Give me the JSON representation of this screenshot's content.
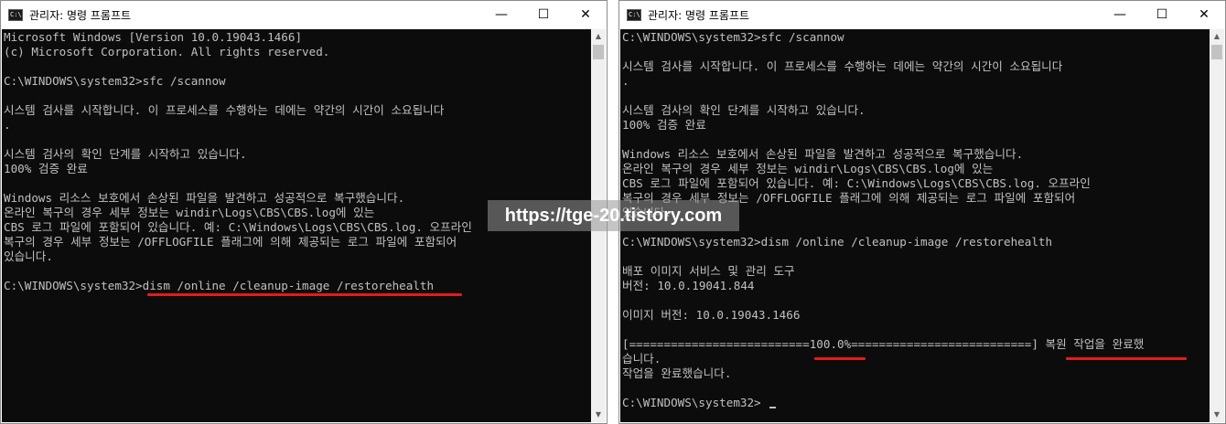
{
  "colors": {
    "console_bg": "#0c0c0c",
    "console_fg": "#c0c0c0",
    "highlight": "#e31b1b"
  },
  "left_window": {
    "title": "관리자: 명령 프롬프트",
    "icon_label": "C:\\",
    "controls": {
      "minimize": "—",
      "maximize": "☐",
      "close": "✕"
    },
    "lines": [
      "Microsoft Windows [Version 10.0.19043.1466]",
      "(c) Microsoft Corporation. All rights reserved.",
      "",
      "C:\\WINDOWS\\system32>sfc /scannow",
      "",
      "시스템 검사를 시작합니다. 이 프로세스를 수행하는 데에는 약간의 시간이 소요됩니다",
      ".",
      "",
      "시스템 검사의 확인 단계를 시작하고 있습니다.",
      "100% 검증 완료",
      "",
      "Windows 리소스 보호에서 손상된 파일을 발견하고 성공적으로 복구했습니다.",
      "온라인 복구의 경우 세부 정보는 windir\\Logs\\CBS\\CBS.log에 있는",
      "CBS 로그 파일에 포함되어 있습니다. 예: C:\\Windows\\Logs\\CBS\\CBS.log. 오프라인",
      "복구의 경우 세부 정보는 /OFFLOGFILE 플래그에 의해 제공되는 로그 파일에 포함되어",
      "있습니다.",
      "",
      "C:\\WINDOWS\\system32>dism /online /cleanup-image /restorehealth"
    ]
  },
  "right_window": {
    "title": "관리자: 명령 프롬프트",
    "icon_label": "C:\\",
    "controls": {
      "minimize": "—",
      "maximize": "☐",
      "close": "✕"
    },
    "lines": [
      "C:\\WINDOWS\\system32>sfc /scannow",
      "",
      "시스템 검사를 시작합니다. 이 프로세스를 수행하는 데에는 약간의 시간이 소요됩니다",
      ".",
      "",
      "시스템 검사의 확인 단계를 시작하고 있습니다.",
      "100% 검증 완료",
      "",
      "Windows 리소스 보호에서 손상된 파일을 발견하고 성공적으로 복구했습니다.",
      "온라인 복구의 경우 세부 정보는 windir\\Logs\\CBS\\CBS.log에 있는",
      "CBS 로그 파일에 포함되어 있습니다. 예: C:\\Windows\\Logs\\CBS\\CBS.log. 오프라인",
      "복구의 경우 세부 정보는 /OFFLOGFILE 플래그에 의해 제공되는 로그 파일에 포함되어",
      "있습니다.",
      "",
      "C:\\WINDOWS\\system32>dism /online /cleanup-image /restorehealth",
      "",
      "배포 이미지 서비스 및 관리 도구",
      "버전: 10.0.19041.844",
      "",
      "이미지 버전: 10.0.19043.1466",
      "",
      "[==========================100.0%==========================] 복원 작업을 완료했",
      "습니다.",
      "작업을 완료했습니다.",
      "",
      "C:\\WINDOWS\\system32>"
    ]
  },
  "watermark": "https://tge-20.tistory.com"
}
